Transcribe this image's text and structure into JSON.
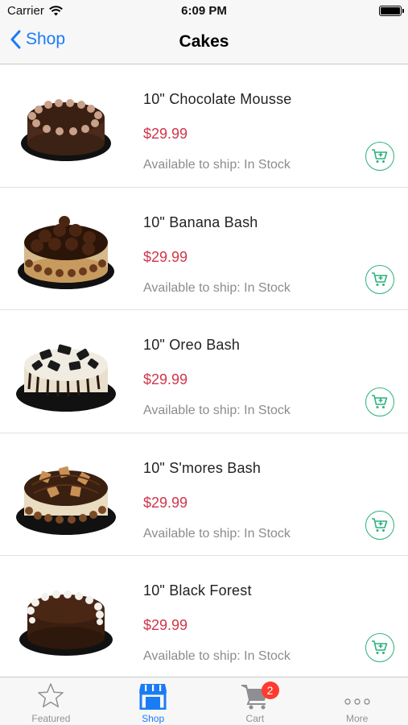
{
  "status_bar": {
    "carrier": "Carrier",
    "time": "6:09 PM"
  },
  "nav": {
    "back_label": "Shop",
    "title": "Cakes"
  },
  "products": [
    {
      "name": "10\" Chocolate Mousse",
      "price": "$29.99",
      "availability": "Available to ship: In Stock"
    },
    {
      "name": "10\" Banana Bash",
      "price": "$29.99",
      "availability": "Available to ship: In Stock"
    },
    {
      "name": "10\" Oreo Bash",
      "price": "$29.99",
      "availability": "Available to ship: In Stock"
    },
    {
      "name": "10\" S'mores Bash",
      "price": "$29.99",
      "availability": "Available to ship: In Stock"
    },
    {
      "name": "10\" Black Forest",
      "price": "$29.99",
      "availability": "Available to ship: In Stock"
    }
  ],
  "tab_bar": {
    "tabs": [
      {
        "label": "Featured",
        "icon": "star-icon",
        "active": false
      },
      {
        "label": "Shop",
        "icon": "store-icon",
        "active": true
      },
      {
        "label": "Cart",
        "icon": "cart-icon",
        "active": false,
        "badge": "2"
      },
      {
        "label": "More",
        "icon": "more-icon",
        "active": false
      }
    ]
  },
  "colors": {
    "accent": "#1a7cf5",
    "price": "#d0364b",
    "cart_button": "#2ab27b",
    "badge": "#ff3b30"
  }
}
